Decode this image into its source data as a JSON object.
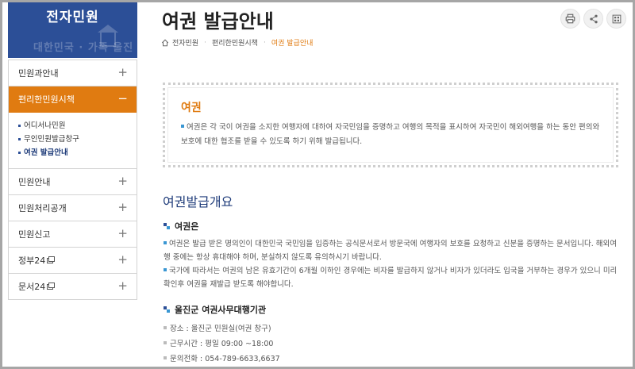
{
  "sidebar": {
    "banner_title": "전자민원",
    "banner_deco": "대한민국 · 가족 울진",
    "items": [
      {
        "label": "민원과안내",
        "toggle": "+"
      },
      {
        "label": "편리한민원시책",
        "toggle": "−"
      },
      {
        "label": "민원안내",
        "toggle": "+"
      },
      {
        "label": "민원처리공개",
        "toggle": "+"
      },
      {
        "label": "민원신고",
        "toggle": "+"
      },
      {
        "label": "정부24",
        "toggle": "+"
      },
      {
        "label": "문서24",
        "toggle": "+"
      }
    ],
    "sub_items": [
      {
        "label": "어디서나민원"
      },
      {
        "label": "무인민원발급창구"
      },
      {
        "label": "여권 발급안내"
      }
    ]
  },
  "page": {
    "title": "여권 발급안내",
    "breadcrumb": [
      "전자민원",
      "편리한민원시책",
      "여권 발급안내"
    ]
  },
  "tools": {
    "print_icon": "print-icon",
    "share_icon": "share-icon",
    "qr_icon": "qr-code-icon"
  },
  "intro": {
    "title": "여권",
    "text": "여권은 각 국이 여권을 소지한 여행자에 대하여 자국민임을 증명하고 여행의 목적을 표시하여 자국민이 해외여행을 하는 동안 편의와 보호에 대한 협조를 받을 수 있도록 하기 위해 발급됩니다."
  },
  "overview": {
    "title": "여권발급개요",
    "what_is": {
      "heading": "여권은",
      "para1": "여권은 발급 받은 명의인이 대한민국 국민임을 입증하는 공식문서로서 방문국에 여행자의 보호를 요청하고 신분을 증명하는 문서입니다. 해외여행 중에는 항상 휴대해야 하며, 분실하지 않도록 유의하시기 바랍니다.",
      "para2": "국가에 따라서는 여권의 남은 유효기간이 6개월 이하인 경우에는 비자를 발급하지 않거나 비자가 있더라도 입국을 거부하는 경우가 있으니 미리 확인후 여권을 재발급 받도록 해야합니다."
    },
    "office": {
      "heading": "울진군 여권사무대행기관",
      "place": "장소 : 울진군 민원실(여권 창구)",
      "hours": "근무시간 : 평일 09:00 ~18:00",
      "phone": "문의전화 : 054-789-6633,6637"
    }
  },
  "colors": {
    "brand_blue": "#2c4f97",
    "accent_orange": "#e07b11",
    "heading_navy": "#1f3c7a",
    "bullet_blue": "#3a97d3"
  }
}
